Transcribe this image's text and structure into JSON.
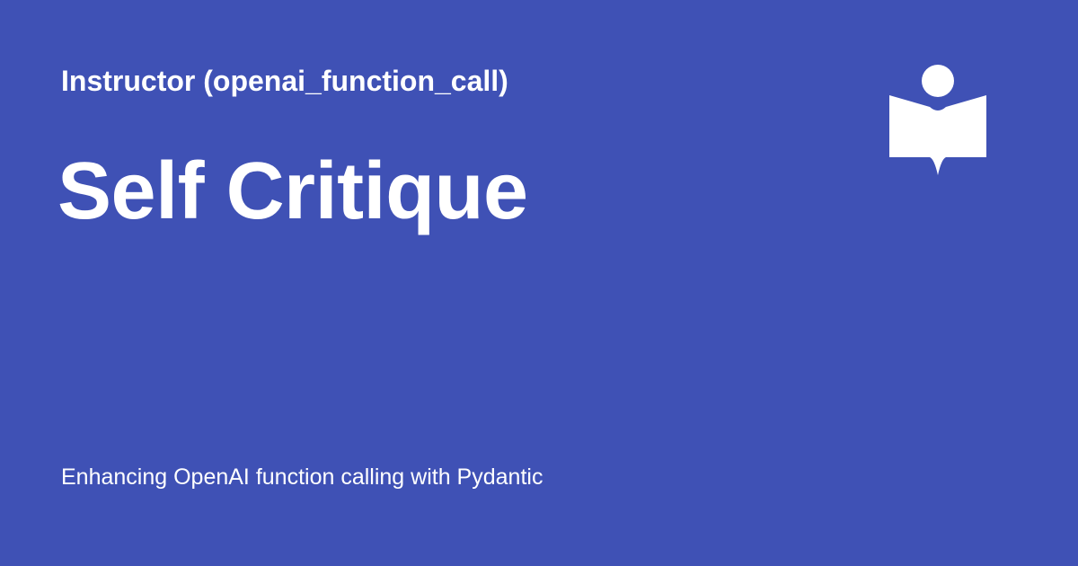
{
  "card": {
    "site_name": "Instructor (openai_function_call)",
    "page_title": "Self Critique",
    "site_description": "Enhancing OpenAI function calling with Pydantic",
    "logo_icon": "book-reader-icon",
    "background_color": "#3f51b5",
    "text_color": "#ffffff"
  }
}
